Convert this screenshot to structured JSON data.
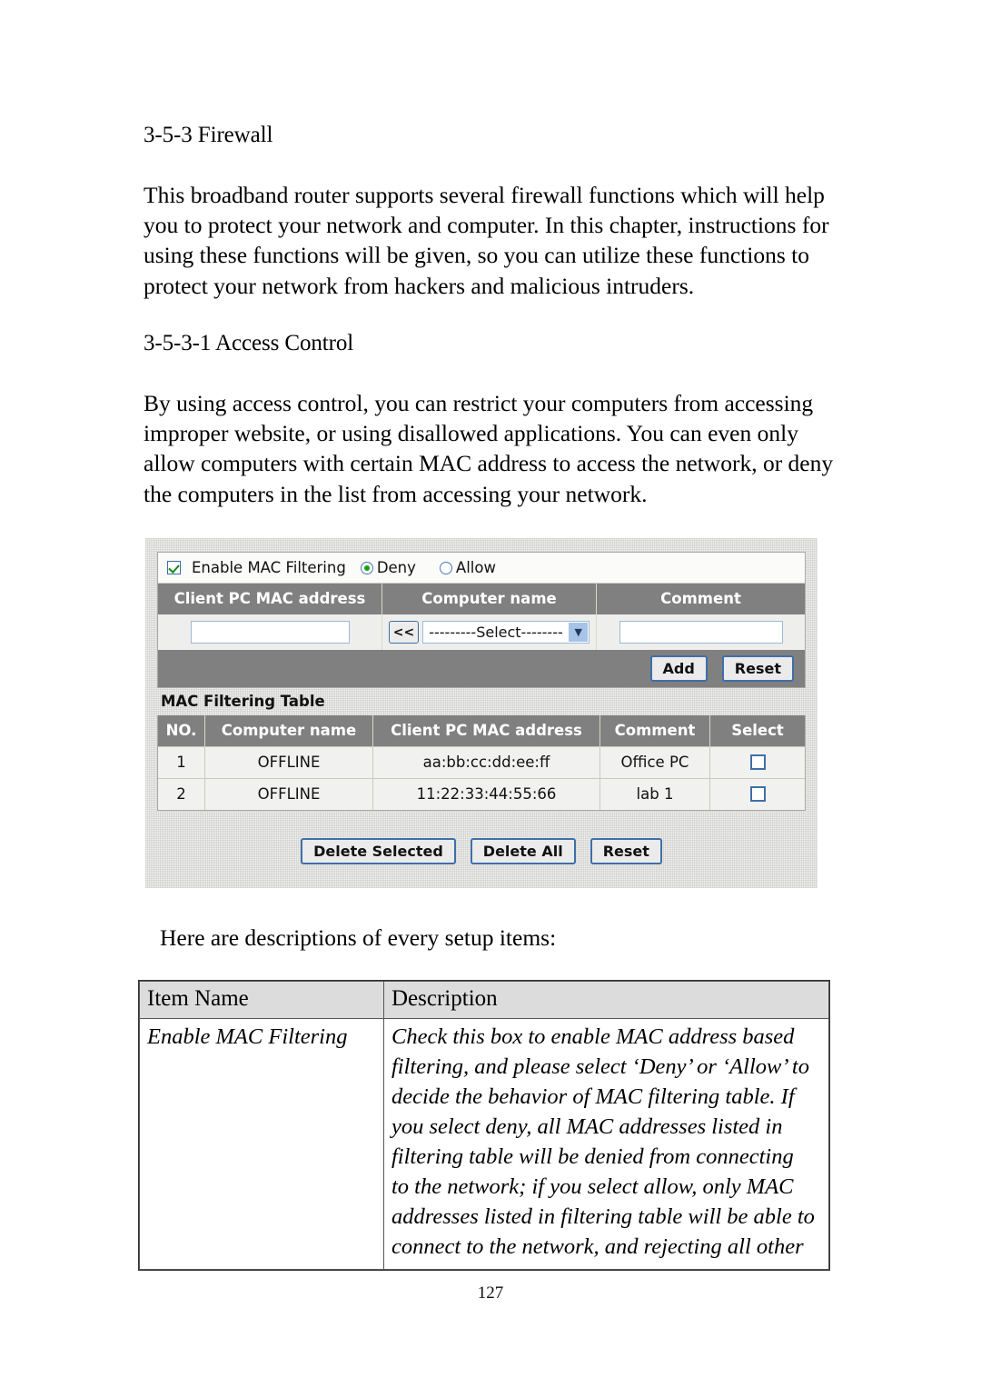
{
  "document": {
    "page_number": "127",
    "sections": [
      {
        "heading": "3-5-3 Firewall",
        "paragraph": "This broadband router supports several firewall functions which will help you to protect your network and computer. In this chapter, instructions for using these functions will be given, so you can utilize these functions to protect your network from hackers and malicious intruders."
      },
      {
        "heading": "3-5-3-1 Access Control",
        "paragraph": "By using access control, you can restrict your computers from accessing improper website, or using disallowed applications. You can even only allow computers with certain MAC address to access the network, or deny the computers in the list from accessing your network."
      }
    ],
    "intro_line": "Here are descriptions of every setup items:"
  },
  "screenshot": {
    "enable_row": {
      "checkbox_checked": true,
      "checkbox_icon": "checkbox-checked-icon",
      "label": "Enable MAC Filtering",
      "radios": [
        {
          "label": "Deny",
          "selected": true
        },
        {
          "label": "Allow",
          "selected": false
        }
      ]
    },
    "entry_form": {
      "headers": [
        "Client PC MAC address",
        "Computer name",
        "Comment"
      ],
      "mac_input_value": "",
      "copy_button_label": "<<",
      "select_value": "---------Select--------",
      "select_arrow_icon": "chevron-down-icon",
      "comment_input_value": "",
      "buttons": [
        "Add",
        "Reset"
      ]
    },
    "filtering_table": {
      "title": "MAC Filtering Table",
      "headers": [
        "NO.",
        "Computer name",
        "Client PC MAC address",
        "Comment",
        "Select"
      ],
      "rows": [
        {
          "no": "1",
          "computer_name": "OFFLINE",
          "mac": "aa:bb:cc:dd:ee:ff",
          "comment": "Office PC",
          "selected": false
        },
        {
          "no": "2",
          "computer_name": "OFFLINE",
          "mac": "11:22:33:44:55:66",
          "comment": "lab 1",
          "selected": false
        }
      ]
    },
    "bottom_buttons": [
      "Delete Selected",
      "Delete All",
      "Reset"
    ],
    "colors": {
      "header_gray": "#808080",
      "row_bg": "#f1f1ef",
      "button_border_blue": "#3f6fa8",
      "check_green": "#148a14"
    }
  },
  "description_table": {
    "headers": [
      "Item Name",
      "Description"
    ],
    "rows": [
      {
        "item": "Enable MAC Filtering",
        "lines": [
          "Check this box to enable MAC address based",
          "filtering, and please select ‘Deny’ or ‘Allow’ to",
          "decide the behavior of MAC filtering table. If",
          "you select deny, all MAC addresses listed in",
          "filtering table will be denied from connecting",
          "to the network; if you select allow, only MAC",
          "addresses listed in filtering table will be able to",
          "connect to the network, and rejecting all other"
        ]
      }
    ]
  }
}
